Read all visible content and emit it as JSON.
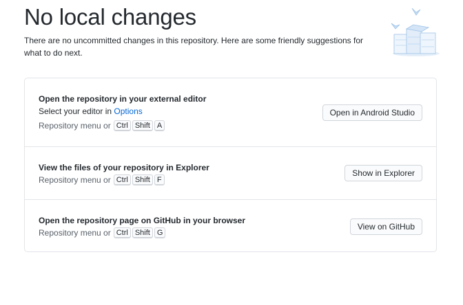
{
  "header": {
    "title": "No local changes",
    "subtitle": "There are no uncommitted changes in this repository. Here are some friendly suggestions for what to do next."
  },
  "illustration": {
    "icon": "empty-changes-illustration",
    "accent_color": "#c8def4"
  },
  "suggestions": [
    {
      "title": "Open the repository in your external editor",
      "description_prefix": "Select your editor in ",
      "description_link": "Options",
      "shortcut_label": "Repository menu or",
      "keys": [
        "Ctrl",
        "Shift",
        "A"
      ],
      "button_label": "Open in Android Studio"
    },
    {
      "title": "View the files of your repository in Explorer",
      "shortcut_label": "Repository menu or",
      "keys": [
        "Ctrl",
        "Shift",
        "F"
      ],
      "button_label": "Show in Explorer"
    },
    {
      "title": "Open the repository page on GitHub in your browser",
      "shortcut_label": "Repository menu or",
      "keys": [
        "Ctrl",
        "Shift",
        "G"
      ],
      "button_label": "View on GitHub"
    }
  ],
  "colors": {
    "link": "#0366d6",
    "border": "#e1e4e8",
    "text": "#24292e",
    "muted": "#586069"
  }
}
